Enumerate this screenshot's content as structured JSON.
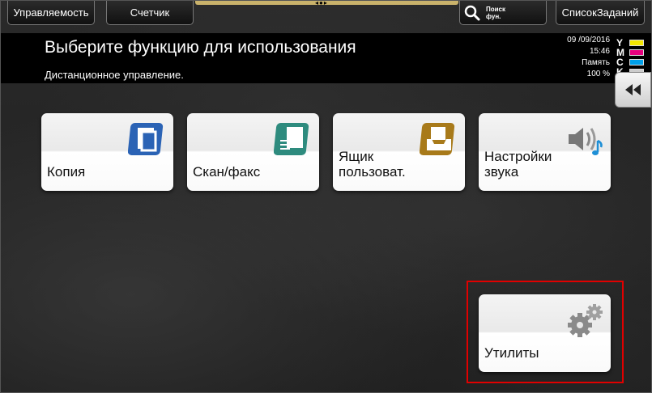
{
  "top_bar": {
    "manage_label": "Управляемость",
    "counter_label": "Счетчик",
    "search_label": "Поиск\nфун.",
    "joblist_label": "СписокЗаданий"
  },
  "header": {
    "title": "Выберите функцию для использования",
    "subtitle": "Дистанционное управление."
  },
  "status": {
    "date": "09 /09/2016",
    "time": "15:46",
    "memory_label": "Память",
    "memory_value": "100 %"
  },
  "toner": [
    {
      "letter": "Y",
      "color": "#f2e600"
    },
    {
      "letter": "M",
      "color": "#e6007e"
    },
    {
      "letter": "C",
      "color": "#00a0e9"
    },
    {
      "letter": "K",
      "color": "#cccccc"
    }
  ],
  "tiles": {
    "copy": {
      "label": "Копия",
      "icon": "copy-icon"
    },
    "scan": {
      "label": "Скан/факс",
      "icon": "scan-fax-icon"
    },
    "box": {
      "label": "Ящик\nпользоват.",
      "icon": "user-box-icon"
    },
    "sound": {
      "label": "Настройки\nзвука",
      "icon": "sound-icon"
    },
    "utility": {
      "label": "Утилиты",
      "icon": "gear-icon"
    }
  },
  "colors": {
    "highlight": "#e10000",
    "copy_icon": "#2b63b5",
    "scan_icon": "#2e8b7e",
    "box_icon": "#a87a1a"
  }
}
